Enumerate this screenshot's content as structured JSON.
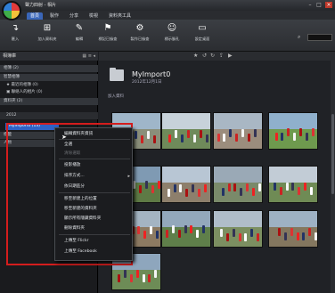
{
  "window": {
    "title": "聲力四射 - 相片",
    "min": "–",
    "max": "□",
    "close": "×"
  },
  "menu": [
    "首頁",
    "製作",
    "分享",
    "檢視",
    "資料夾工具"
  ],
  "toolbar": [
    {
      "label": "匯入",
      "icon": "import-icon"
    },
    {
      "label": "加入資料夾",
      "icon": "add-folder-icon"
    },
    {
      "label": "編輯",
      "icon": "edit-icon"
    },
    {
      "label": "標記已檢查",
      "icon": "flag-icon"
    },
    {
      "label": "製作已檢查",
      "icon": "make-icon"
    },
    {
      "label": "標示臉孔",
      "icon": "face-icon"
    },
    {
      "label": "設定桌面",
      "icon": "desktop-icon"
    }
  ],
  "left": {
    "header": "相簿庫",
    "rows": [
      {
        "label": "相簿 (2)",
        "type": "section"
      },
      {
        "label": "智慧相簿",
        "type": "section"
      },
      {
        "label": "★ 最近的相簿 (0)",
        "type": "item"
      },
      {
        "label": "▣ 聯絡人的相片 (0)",
        "type": "item"
      },
      {
        "label": "資料夾 (2)",
        "type": "section"
      },
      {
        "label": "2012",
        "type": "item"
      },
      {
        "label": "MyImport0 (13)",
        "type": "selected"
      },
      {
        "label": "標籤",
        "type": "section"
      },
      {
        "label": "人物",
        "type": "section"
      }
    ]
  },
  "context_menu": [
    {
      "label": "編輯資料夾資訊",
      "enabled": true
    },
    {
      "label": "全選",
      "enabled": true
    },
    {
      "label": "清除選取",
      "enabled": false
    },
    {
      "label": "投影播放",
      "enabled": true
    },
    {
      "label": "排序方式...",
      "enabled": true,
      "submenu": true
    },
    {
      "label": "依日期區分",
      "enabled": true
    },
    {
      "label": "移至新建上的位置",
      "enabled": true
    },
    {
      "label": "移至新建的資料夾",
      "enabled": true
    },
    {
      "label": "顯示所有隱藏資料夾",
      "enabled": true
    },
    {
      "label": "刪除資料夾",
      "enabled": true
    },
    {
      "label": "上傳至 Flickr",
      "enabled": true
    },
    {
      "label": "上傳至 Facebook",
      "enabled": true
    }
  ],
  "content": {
    "folder_name": "MyImport0",
    "folder_date": "2012年12月1日",
    "sub_label": "加入資料"
  }
}
